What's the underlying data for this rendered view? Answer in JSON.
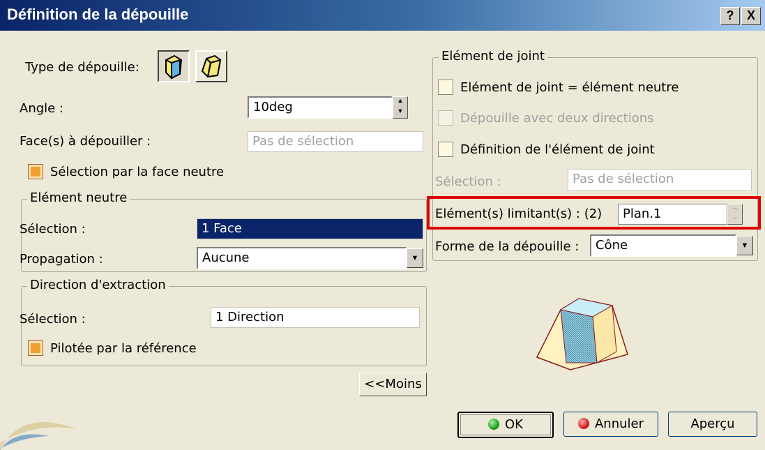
{
  "window": {
    "title": "Définition de la dépouille",
    "help_label": "?",
    "close_label": "X"
  },
  "left": {
    "type_label": "Type de dépouille:",
    "type_icons": [
      "draft-type-standard-icon",
      "draft-type-variable-icon"
    ],
    "angle_label": "Angle :",
    "angle_value": "10deg",
    "faces_label": "Face(s) à dépouiller :",
    "faces_placeholder": "Pas de sélection",
    "neutral_face_check_label": "Sélection par la face neutre",
    "neutral_group": {
      "title": "Elément neutre",
      "selection_label": "Sélection :",
      "selection_value": "1 Face",
      "propagation_label": "Propagation :",
      "propagation_value": "Aucune"
    },
    "direction_group": {
      "title": "Direction d'extraction",
      "selection_label": "Sélection :",
      "selection_value": "1 Direction",
      "reference_check_label": "Pilotée par la référence"
    },
    "less_button": "<<Moins"
  },
  "right": {
    "joint_group": {
      "title": "Elément de joint",
      "check1": "Elément de joint = élément neutre",
      "check2": "Dépouille avec deux directions",
      "check3": "Définition de l'élément de joint",
      "selection_label": "Sélection :",
      "selection_placeholder": "Pas de sélection",
      "limiting_label": "Elément(s) limitant(s) : (2)",
      "limiting_value": "Plan.1",
      "shape_label": "Forme de la dépouille :",
      "shape_value": "Cône"
    }
  },
  "buttons": {
    "ok": "OK",
    "cancel": "Annuler",
    "preview": "Aperçu"
  },
  "colors": {
    "highlight_box": "#e00000",
    "selected_field": "#0a246a",
    "ok_dot": "#1fa21f",
    "cancel_dot": "#d42020"
  }
}
